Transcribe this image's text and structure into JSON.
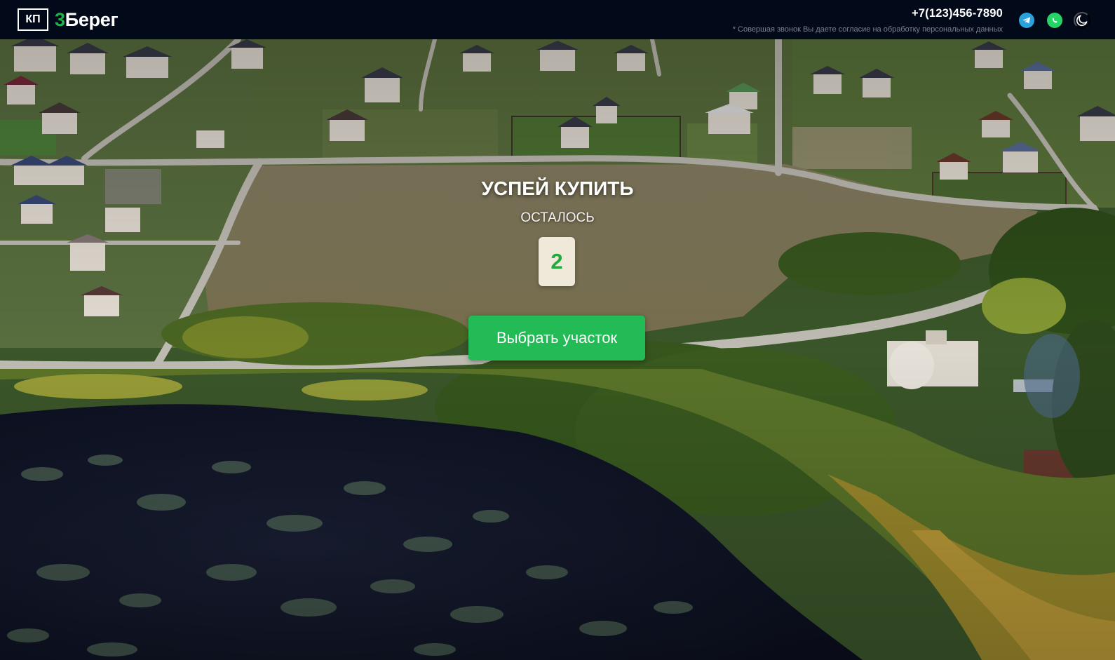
{
  "header": {
    "logo_badge": "КП",
    "logo_number": "3",
    "logo_word": "Берег",
    "phone": "+7(123)456-7890",
    "consent": "* Совершая звонок Вы даете согласие на обработку персональных данных",
    "icons": [
      "telegram-icon",
      "whatsapp-icon",
      "moon-icon"
    ]
  },
  "hero": {
    "title": "УСПЕЙ КУПИТЬ",
    "subtitle": "ОСТАЛОСЬ",
    "remaining": "2",
    "cta_label": "Выбрать участок"
  },
  "colors": {
    "header_bg": "#020a1a",
    "accent": "#22bb55",
    "counter_bg": "#efe9d9",
    "counter_text": "#22a83c"
  }
}
